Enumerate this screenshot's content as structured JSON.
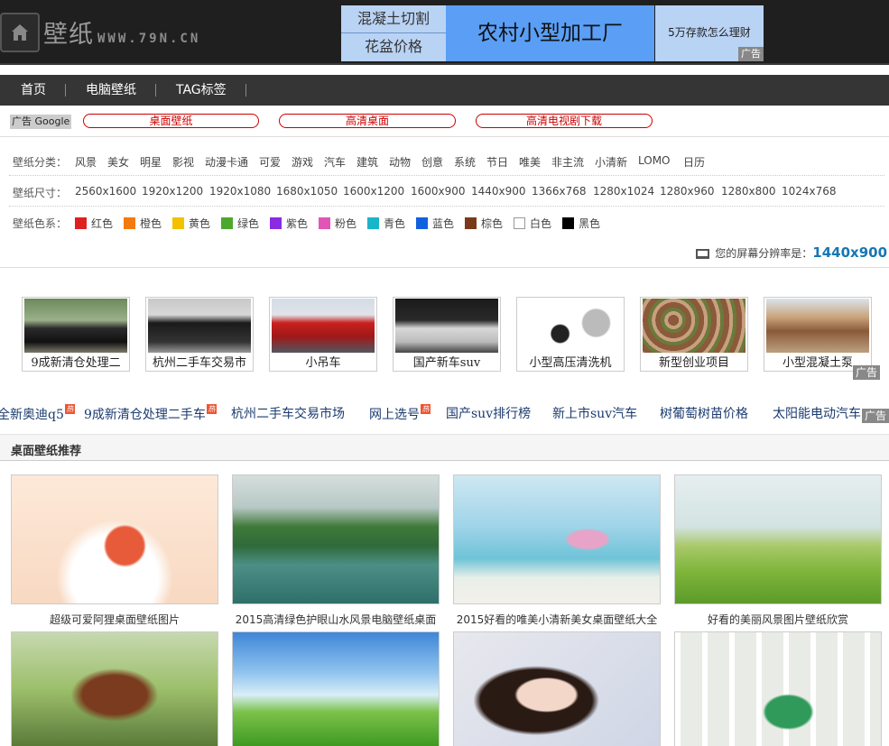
{
  "header": {
    "logo_cn": "壁纸",
    "logo_url": "WWW.79N.CN",
    "ad_left": [
      "混凝土切割",
      "花盆价格"
    ],
    "ad_mid": "农村小型加工厂",
    "ad_right": "5万存款怎么理财",
    "ad_tag": "广告"
  },
  "nav": [
    "首页",
    "电脑壁纸",
    "TAG标签"
  ],
  "google_bar": {
    "tag": "广告 Google",
    "pills": [
      "桌面壁纸",
      "高清桌面",
      "高清电视剧下载"
    ]
  },
  "filters": {
    "category_label": "壁纸分类：",
    "categories": [
      "风景",
      "美女",
      "明星",
      "影视",
      "动漫卡通",
      "可爱",
      "游戏",
      "汽车",
      "建筑",
      "动物",
      "创意",
      "系统",
      "节日",
      "唯美",
      "非主流",
      "小清新",
      "LOMO",
      "日历"
    ],
    "size_label": "壁纸尺寸：",
    "sizes": [
      "2560x1600",
      "1920x1200",
      "1920x1080",
      "1680x1050",
      "1600x1200",
      "1600x900",
      "1440x900",
      "1366x768",
      "1280x1024",
      "1280x960",
      "1280x800",
      "1024x768"
    ],
    "color_label": "壁纸色系：",
    "colors": [
      {
        "name": "红色",
        "hex": "#e02020"
      },
      {
        "name": "橙色",
        "hex": "#f47a10"
      },
      {
        "name": "黄色",
        "hex": "#f2c200"
      },
      {
        "name": "绿色",
        "hex": "#4ca82c"
      },
      {
        "name": "紫色",
        "hex": "#8a2be2"
      },
      {
        "name": "粉色",
        "hex": "#e055b5"
      },
      {
        "name": "青色",
        "hex": "#1ab5c8"
      },
      {
        "name": "蓝色",
        "hex": "#1060e0"
      },
      {
        "name": "棕色",
        "hex": "#7a3a1a"
      },
      {
        "name": "白色",
        "hex": "#ffffff"
      },
      {
        "name": "黑色",
        "hex": "#000000"
      }
    ],
    "screen_label": "您的屏幕分辨率是：",
    "screen_value": "1440x900"
  },
  "ad_cards": [
    "9成新清仓处理二",
    "杭州二手车交易市",
    "小吊车",
    "国产新车suv",
    "小型高压清洗机",
    "新型创业项目",
    "小型混凝土泵"
  ],
  "ad_strip_tag": "广告",
  "text_links": [
    "全新奥迪q5",
    "9成新清仓处理二手车",
    "杭州二手车交易市场",
    "网上选号",
    "国产suv排行榜",
    "新上市suv汽车",
    "树葡萄树苗价格",
    "太阳能电动汽车"
  ],
  "hot_label": "热",
  "text_links_tag": "广告",
  "section_title": "桌面壁纸推荐",
  "wallpapers": [
    "超级可爱阿狸桌面壁纸图片",
    "2015高清绿色护眼山水风景电脑壁纸桌面",
    "2015好看的唯美小清新美女桌面壁纸大全",
    "好看的美丽风景图片壁纸欣赏"
  ]
}
